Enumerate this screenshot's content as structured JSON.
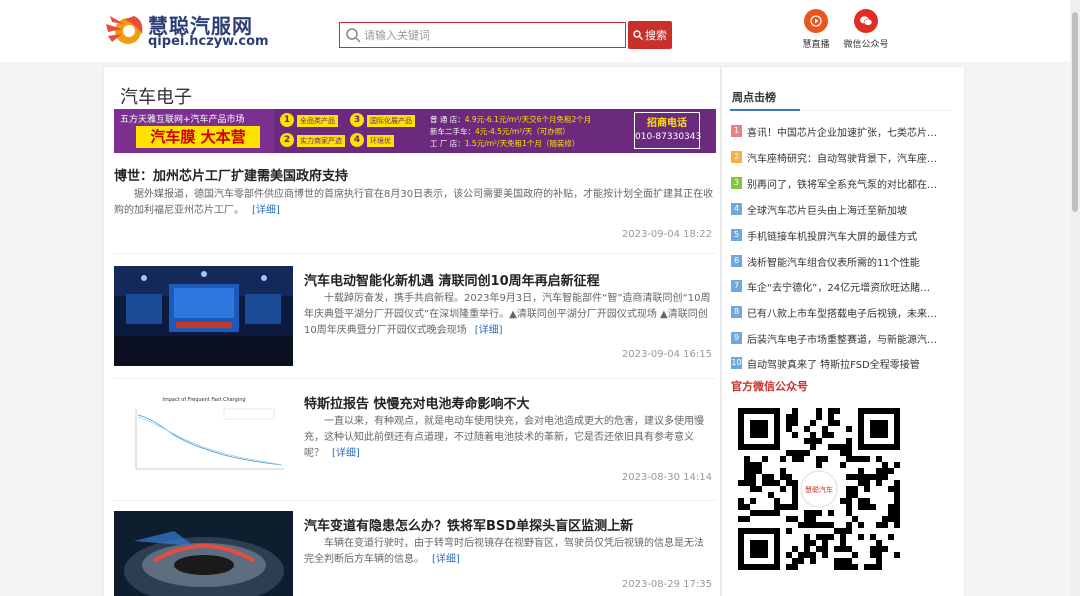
{
  "header": {
    "logo_title": "慧聪汽服网",
    "logo_url": "qipei.hczyw.com",
    "search_placeholder": "请输入关键词",
    "search_button": "搜索",
    "links": [
      {
        "label": "慧直播",
        "icon": "play-icon",
        "color": "#e8561e"
      },
      {
        "label": "微信公众号",
        "icon": "wechat-icon",
        "color": "#e02e24"
      }
    ]
  },
  "main": {
    "title": "汽车电子",
    "banner": {
      "left_line1": "五方天雅互联网+汽车产品市场",
      "left_line2": "汽车膜 大本营",
      "items": [
        {
          "num": "1",
          "label": "全品类产品"
        },
        {
          "num": "2",
          "label": "实力商家严选"
        },
        {
          "num": "3",
          "label": "国际化展产品"
        },
        {
          "num": "4",
          "label": "环境优"
        }
      ],
      "rates": [
        {
          "label": "普 通 店：",
          "value": "4.9元-6.1元/m²/天交6个月免租2个月"
        },
        {
          "label": "新车二手车：",
          "value": "4元-4.5元/m²/天（可办照）"
        },
        {
          "label": "工 厂 店：",
          "value": "1.5元/m²/天免租1个月（随装修）"
        }
      ],
      "phone_title": "招商电话",
      "phone": "010-87330343"
    },
    "articles": [
      {
        "title": "博世：加州芯片工厂扩建需美国政府支持",
        "summary": "据外媒报道，德国汽车零部件供应商博世的首席执行官在8月30日表示，该公司需要美国政府的补贴，才能按计划全面扩建其正在收购的加利福尼亚州芯片工厂。",
        "more": "[详细]",
        "date": "2023-09-04 18:22",
        "has_thumb": false
      },
      {
        "title": "汽车电动智能化新机遇 清联同创10周年再启新征程",
        "summary": "十载踔厉奋发，携手共启新程。2023年9月3日，汽车智能部件“智”造商清联同创“10周年庆典暨平湖分厂开园仪式”在深圳隆重举行。▲清联同创平湖分厂开园仪式现场 ▲清联同创10周年庆典暨分厂开园仪式晚会现场",
        "more": "[详细]",
        "date": "2023-09-04 16:15",
        "has_thumb": true,
        "thumb": "stage-event"
      },
      {
        "title": "特斯拉报告 快慢充对电池寿命影响不大",
        "summary": "一直以来，有种观点，就是电动车使用快充，会对电池造成更大的危害，建议多使用慢充，这种认知此前倒还有点道理，不过随着电池技术的革新，它是否还依旧具有参考意义呢？",
        "more": "[详细]",
        "date": "2023-08-30 14:14",
        "has_thumb": true,
        "thumb": "chart",
        "thumb_chart_title": "Impact of Frequent Fast Charging"
      },
      {
        "title": "汽车变道有隐患怎么办？铁将军BSD单探头盲区监测上新",
        "summary": "车辆在变道行驶时，由于转弯时后视镜存在视野盲区，驾驶员仅凭后视镜的信息是无法完全判断后方车辆的信息。",
        "more": "[详细]",
        "date": "2023-08-29 17:35",
        "has_thumb": true,
        "thumb": "sensor"
      }
    ]
  },
  "sidebar": {
    "tab": "周点击榜",
    "ranking": [
      {
        "num": "1",
        "text": "喜讯！中国芯片企业加速扩张，七类芯片…",
        "color": "#f08080"
      },
      {
        "num": "2",
        "text": "汽车座椅研究：自动驾驶背景下，汽车座…",
        "color": "#f5b041"
      },
      {
        "num": "3",
        "text": "别再问了，铁将军全系充气泵的对比都在…",
        "color": "#82c341"
      },
      {
        "num": "4",
        "text": "全球汽车芯片巨头由上海迁至新加坡",
        "color": "#6fa8dc"
      },
      {
        "num": "5",
        "text": "手机链接车机投屏汽车大屏的最佳方式",
        "color": "#6fa8dc"
      },
      {
        "num": "6",
        "text": "浅析智能汽车组合仪表所需的11个性能",
        "color": "#6fa8dc"
      },
      {
        "num": "7",
        "text": "车企“去宁德化”，24亿元增资欣旺达賭…",
        "color": "#6fa8dc"
      },
      {
        "num": "8",
        "text": "已有八款上市车型搭载电子后视镜，未来…",
        "color": "#6fa8dc"
      },
      {
        "num": "9",
        "text": "后装汽车电子市场重整赛道，与新能源汽…",
        "color": "#6fa8dc"
      },
      {
        "num": "10",
        "text": "自动驾驶真来了 特斯拉FSD全程零接管",
        "color": "#6fa8dc"
      }
    ],
    "wechat_title": "官方微信公众号",
    "qr_brand": "慧聪汽车"
  }
}
